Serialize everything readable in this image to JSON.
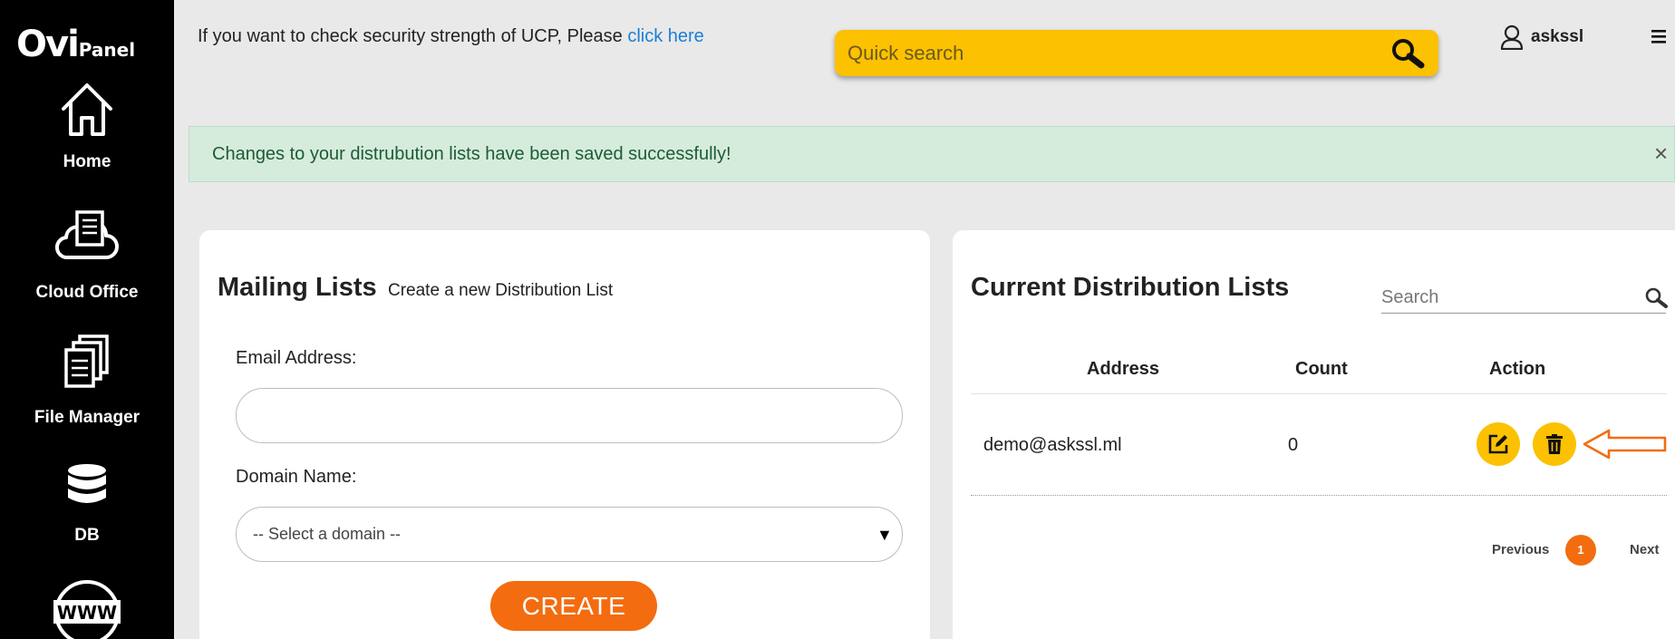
{
  "app": {
    "logo_big": "Ovi",
    "logo_small": "Panel"
  },
  "sidebar": {
    "items": [
      {
        "label": "Home",
        "icon": "home-icon"
      },
      {
        "label": "Cloud Office",
        "icon": "cloud-office-icon"
      },
      {
        "label": "File Manager",
        "icon": "file-manager-icon"
      },
      {
        "label": "DB",
        "icon": "database-icon"
      },
      {
        "label": "",
        "icon": "www-icon"
      }
    ]
  },
  "topbar": {
    "security_text": "If you want to check security strength of UCP, Please ",
    "security_link": "click here",
    "search_placeholder": "Quick search",
    "username": "askssl"
  },
  "alert": {
    "message": "Changes to your distrubution lists have been saved successfully!",
    "close": "×"
  },
  "mailing_lists": {
    "title": "Mailing Lists",
    "subtitle": "Create a new Distribution List",
    "email_label": "Email Address:",
    "email_value": "",
    "domain_label": "Domain Name:",
    "domain_selected": "-- Select a domain --",
    "create_label": "CREATE"
  },
  "distribution_lists": {
    "title": "Current Distribution Lists",
    "search_placeholder": "Search",
    "columns": [
      "Address",
      "Count",
      "Action"
    ],
    "rows": [
      {
        "address": "demo@askssl.ml",
        "count": "0"
      }
    ],
    "pagination": {
      "previous": "Previous",
      "current": "1",
      "next": "Next"
    }
  },
  "colors": {
    "accent_yellow": "#fcc100",
    "accent_orange": "#f36c10",
    "alert_bg": "#d5ecdd",
    "link": "#1a7fd4"
  }
}
